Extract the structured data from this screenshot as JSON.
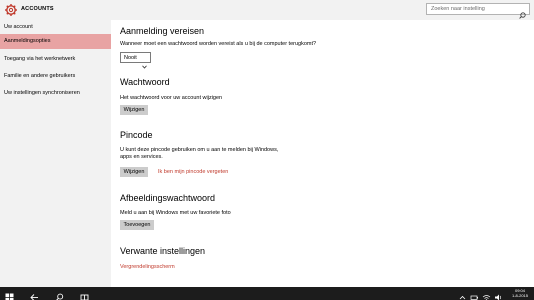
{
  "app": {
    "title": "ACCOUNTS"
  },
  "search": {
    "placeholder": "Zoeken naar instelling"
  },
  "sidebar": {
    "items": [
      {
        "label": "Uw account"
      },
      {
        "label": "Aanmeldingsopties"
      },
      {
        "label": "Toegang via het werknetwerk"
      },
      {
        "label": "Familie en andere gebruikers"
      },
      {
        "label": "Uw instellingen synchroniseren"
      }
    ],
    "active_index": 1
  },
  "main": {
    "signin_required": {
      "heading": "Aanmelding vereisen",
      "question": "Wanneer moet een wachtwoord worden vereist als u bij de computer terugkomt?",
      "select_value": "Nooit"
    },
    "password": {
      "heading": "Wachtwoord",
      "description": "Het wachtwoord voor uw account wijzigen",
      "button": "Wijzigen"
    },
    "pin": {
      "heading": "Pincode",
      "description_line1": "U kunt deze pincode gebruiken om u aan te melden bij Windows,",
      "description_line2": "apps en services.",
      "button": "Wijzigen",
      "forgot_link": "Ik ben mijn pincode vergeten"
    },
    "picture_password": {
      "heading": "Afbeeldingswachtwoord",
      "description": "Meld u aan bij Windows met uw favoriete foto",
      "button": "Toevoegen"
    },
    "related": {
      "heading": "Verwante instellingen",
      "link": "Vergrendelingsscherm"
    }
  },
  "taskbar": {
    "time": "09:04",
    "date": "1-8-2015"
  },
  "colors": {
    "accent_active": "#e8a3a3",
    "link": "#c0392b",
    "taskbar": "#1c1c1c",
    "chrome": "#f2f2f2"
  },
  "icons": [
    "gear-icon",
    "search-icon",
    "chevron-down-icon",
    "windows-start-icon",
    "back-arrow-icon",
    "cortana-search-icon",
    "task-view-icon"
  ]
}
